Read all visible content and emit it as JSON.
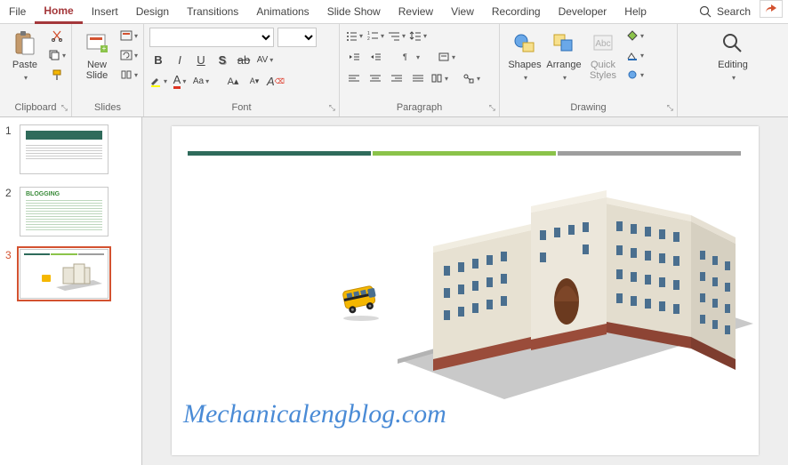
{
  "tabs": [
    "File",
    "Home",
    "Insert",
    "Design",
    "Transitions",
    "Animations",
    "Slide Show",
    "Review",
    "View",
    "Recording",
    "Developer",
    "Help"
  ],
  "active_tab": "Home",
  "search_label": "Search",
  "ribbon": {
    "clipboard": {
      "label": "Clipboard",
      "paste": "Paste"
    },
    "slides": {
      "label": "Slides",
      "new_slide": "New\nSlide"
    },
    "font": {
      "label": "Font"
    },
    "paragraph": {
      "label": "Paragraph"
    },
    "drawing": {
      "label": "Drawing",
      "shapes": "Shapes",
      "arrange": "Arrange",
      "quick_styles": "Quick\nStyles"
    },
    "editing": {
      "label": "Editing",
      "edit": "Editing"
    }
  },
  "slides": [
    {
      "num": "1"
    },
    {
      "num": "2",
      "title": "BLOGGING"
    },
    {
      "num": "3"
    }
  ],
  "current_slide": 3,
  "watermark": "Mechanicalengblog.com",
  "accent_colors": [
    "#2f6b5b",
    "#8bc34a",
    "#9e9e9e"
  ]
}
